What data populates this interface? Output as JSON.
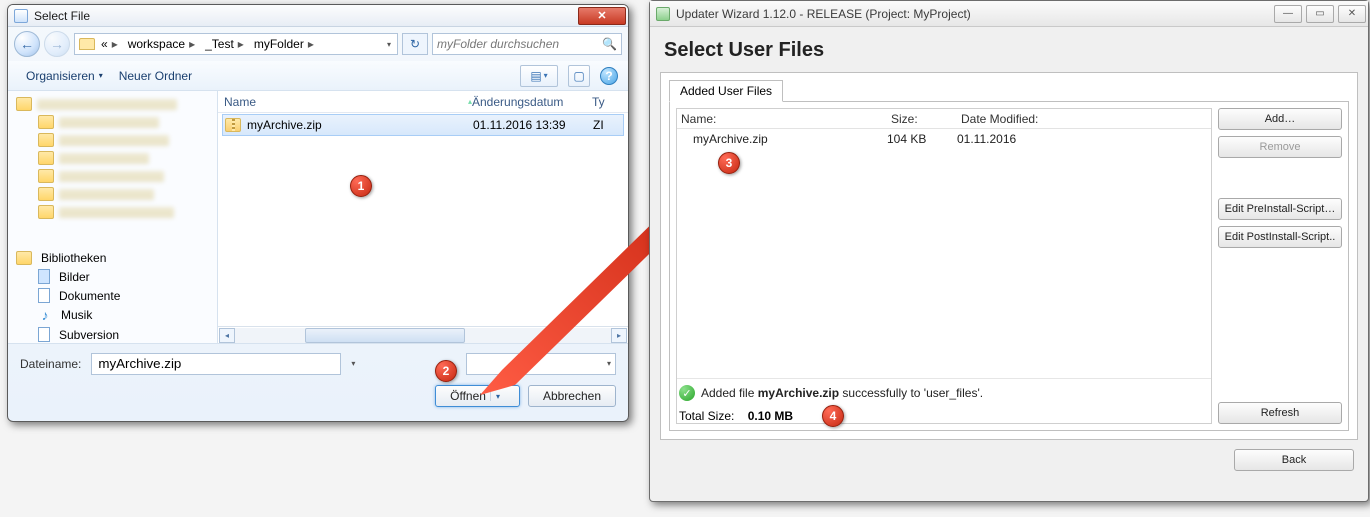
{
  "fileDialog": {
    "title": "Select File",
    "breadcrumb": [
      "«",
      "workspace",
      "_Test",
      "myFolder"
    ],
    "searchPlaceholder": "myFolder durchsuchen",
    "toolbar": {
      "organize": "Organisieren",
      "newFolder": "Neuer Ordner"
    },
    "tree": {
      "libs": "Bibliotheken",
      "items": [
        "Bilder",
        "Dokumente",
        "Musik",
        "Subversion"
      ]
    },
    "columns": {
      "name": "Name",
      "date": "Änderungsdatum",
      "type": "Ty"
    },
    "row": {
      "name": "myArchive.zip",
      "date": "01.11.2016 13:39",
      "type": "ZI"
    },
    "filenameLabel": "Dateiname:",
    "filenameValue": "myArchive.zip",
    "openBtn": "Öffnen",
    "cancelBtn": "Abbrechen"
  },
  "wizard": {
    "title": "Updater Wizard 1.12.0 - RELEASE (Project: MyProject)",
    "heading": "Select User Files",
    "tab": "Added User Files",
    "columns": {
      "name": "Name:",
      "size": "Size:",
      "date": "Date Modified:"
    },
    "row": {
      "name": "myArchive.zip",
      "size": "104 KB",
      "date": "01.11.2016"
    },
    "buttons": {
      "add": "Add…",
      "remove": "Remove",
      "pre": "Edit PreInstall-Script…",
      "post": "Edit PostInstall-Script..",
      "refresh": "Refresh",
      "back": "Back"
    },
    "status": {
      "pre": "Added file ",
      "file": "myArchive.zip",
      "post": " successfully to 'user_files'."
    },
    "total": {
      "label": "Total Size:",
      "value": "0.10 MB"
    }
  },
  "callouts": {
    "c1": "1",
    "c2": "2",
    "c3": "3",
    "c4": "4"
  }
}
